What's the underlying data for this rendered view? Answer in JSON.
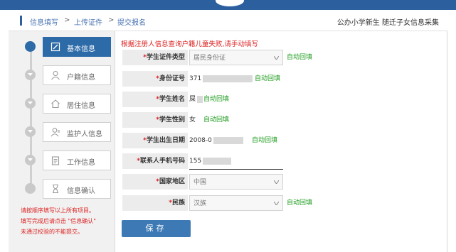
{
  "breadcrumb": {
    "items": [
      "信息填写",
      "上传证件",
      "提交报名"
    ],
    "separator": ">"
  },
  "header_right": "公办小学新生 随迁子女信息采集",
  "steps": [
    {
      "label": "基本信息",
      "icon": "edit-icon",
      "active": true
    },
    {
      "label": "户籍信息",
      "icon": "user-icon",
      "active": false
    },
    {
      "label": "居住信息",
      "icon": "home-icon",
      "active": false
    },
    {
      "label": "监护人信息",
      "icon": "guardian-icon",
      "active": false
    },
    {
      "label": "工作信息",
      "icon": "clipboard-icon",
      "active": false
    },
    {
      "label": "信息确认",
      "icon": "hourglass-icon",
      "active": false
    }
  ],
  "sidebar_hints": [
    "请按顺序填写以上所有项目。",
    "填写完成后请点击 \"信息确认\"",
    "未通过校验的不能提交。"
  ],
  "notice": "根据注册人信息查询户籍儿童失败,请手动填写",
  "form": {
    "star": "*",
    "auto_fill": "自动回填",
    "rows": [
      {
        "label": "学生证件类型",
        "value": "居民身份证",
        "type": "select"
      },
      {
        "label": "身份证号",
        "value": "371",
        "type": "masked"
      },
      {
        "label": "学生姓名",
        "value": "屎",
        "type": "masked"
      },
      {
        "label": "学生性别",
        "value": "女",
        "type": "text"
      },
      {
        "label": "学生出生日期",
        "value": "2008-0",
        "type": "masked"
      },
      {
        "label": "联系人手机号码",
        "value": "155",
        "type": "masked-input"
      },
      {
        "label": "国家地区",
        "value": "中国",
        "type": "select"
      },
      {
        "label": "民族",
        "value": "汉族",
        "type": "select"
      }
    ]
  },
  "save_label": "保存",
  "colors": {
    "primary": "#2c6aa8",
    "auto_fill": "#1a9a1a",
    "warning": "#dd2222"
  }
}
